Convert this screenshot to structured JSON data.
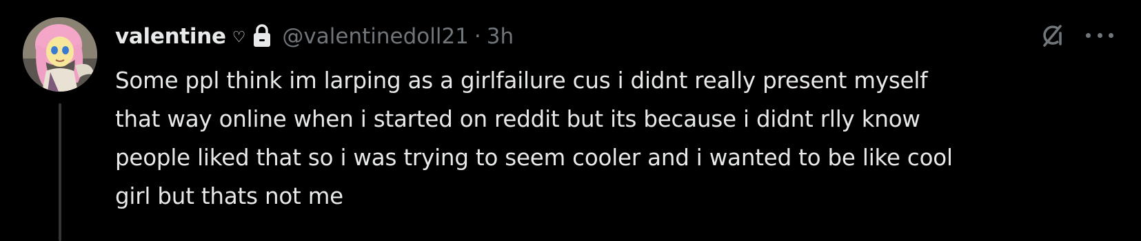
{
  "post": {
    "author": {
      "display_name": "valentine",
      "name_emoji": "♡",
      "protected": true,
      "handle": "@valentinedoll21",
      "avatar": "avatar-image"
    },
    "separator": "·",
    "timestamp": "3h",
    "text_lines": [
      "Some ppl think im larping as a girlfailure cus i didnt really present myself",
      "that way online when i started on reddit but its because i didnt rlly know",
      "people liked that so i was trying to seem cooler and i wanted to be like cool",
      "girl but thats not me"
    ]
  },
  "icons": {
    "lock": "lock-icon",
    "grok": "grok-icon",
    "more": "more-icon"
  },
  "colors": {
    "background": "#000000",
    "primary_text": "#e7e9ea",
    "secondary_text": "#71767b",
    "thread_line": "#333639"
  }
}
